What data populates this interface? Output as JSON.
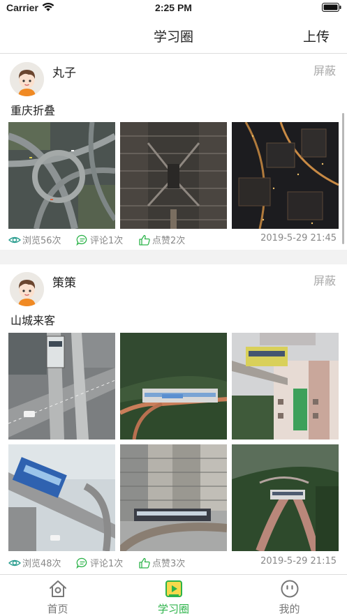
{
  "status_bar": {
    "carrier": "Carrier",
    "time": "2:25 PM"
  },
  "nav": {
    "title": "学习圈",
    "action": "上传"
  },
  "posts": [
    {
      "author": "丸子",
      "hide_label": "屏蔽",
      "text": "重庆折叠",
      "views": "浏览56次",
      "comments": "评论1次",
      "likes": "点赞2次",
      "time": "2019-5-29 21:45"
    },
    {
      "author": "策策",
      "hide_label": "屏蔽",
      "text": "山城来客",
      "views": "浏览48次",
      "comments": "评论1次",
      "likes": "点赞3次",
      "time": "2019-5-29 21:15"
    }
  ],
  "tabs": [
    {
      "label": "首页",
      "icon": "home-icon"
    },
    {
      "label": "学习圈",
      "icon": "play-square-icon"
    },
    {
      "label": "我的",
      "icon": "face-icon"
    }
  ],
  "colors": {
    "accent": "#2db34a",
    "meta_gray": "#888888",
    "stat_icon_green": "#2a9d8f"
  }
}
